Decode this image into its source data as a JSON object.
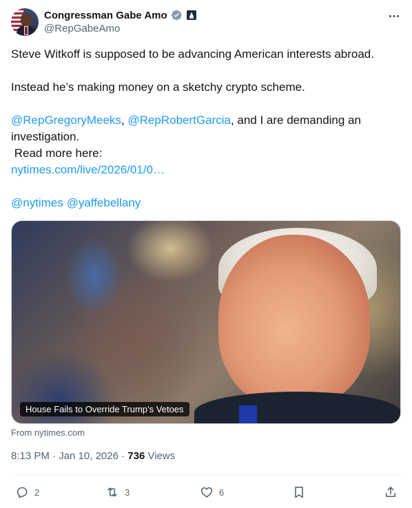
{
  "author": {
    "display_name": "Congressman Gabe Amo",
    "handle": "@RepGabeAmo",
    "verified_icon": "gray-verified-badge-icon",
    "affiliation_icon": "government-affiliation-icon"
  },
  "tweet": {
    "line1": "Steve Witkoff is supposed to be advancing American interests abroad.",
    "line2": "Instead he’s making money on a sketchy crypto scheme.",
    "mention1": "@RepGregoryMeeks",
    "sep1": ", ",
    "mention2": "@RepRobertGarcia",
    "line3_rest": ", and I are demanding an investigation.",
    "read_more": " Read more here:",
    "url": "nytimes.com/live/2026/01/0…",
    "mention3": "@nytimes",
    "sep2": " ",
    "mention4": "@yaffebellany"
  },
  "card": {
    "caption": "House Fails to Override Trump’s Vetoes",
    "source": "From nytimes.com"
  },
  "meta": {
    "time_date": "8:13 PM · Jan 10, 2026 · ",
    "views_count": "736",
    "views_label": " Views"
  },
  "actions": {
    "reply_count": "2",
    "repost_count": "3",
    "like_count": "6"
  },
  "colors": {
    "link": "#1d9bf0",
    "secondary_text": "#536471",
    "verified_badge": "#829aab"
  }
}
